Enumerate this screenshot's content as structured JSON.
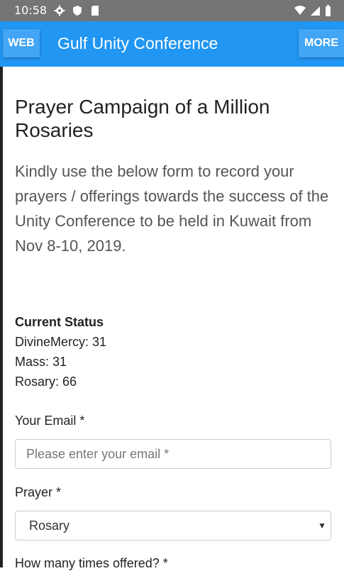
{
  "status_bar": {
    "time": "10:58",
    "left_icons": [
      "settings-icon",
      "shield-icon",
      "sd-card-icon"
    ],
    "right_icons": [
      "wifi-icon",
      "signal-icon",
      "battery-icon"
    ]
  },
  "app_bar": {
    "web_label": "WEB",
    "title": "Gulf Unity Conference",
    "more_label": "MORE",
    "color": "#2196F3"
  },
  "page": {
    "title": "Prayer Campaign of a Million Rosaries",
    "intro": "Kindly use the below form to record your prayers / offerings towards the success of the Unity Conference to be held in Kuwait from Nov 8-10, 2019."
  },
  "status": {
    "heading": "Current Status",
    "lines": [
      "DivineMercy: 31",
      "Mass: 31",
      "Rosary: 66"
    ]
  },
  "form": {
    "email_label": "Your Email *",
    "email_placeholder": "Please enter your email *",
    "prayer_label": "Prayer *",
    "prayer_selected": "Rosary",
    "times_label": "How many times offered? *"
  }
}
